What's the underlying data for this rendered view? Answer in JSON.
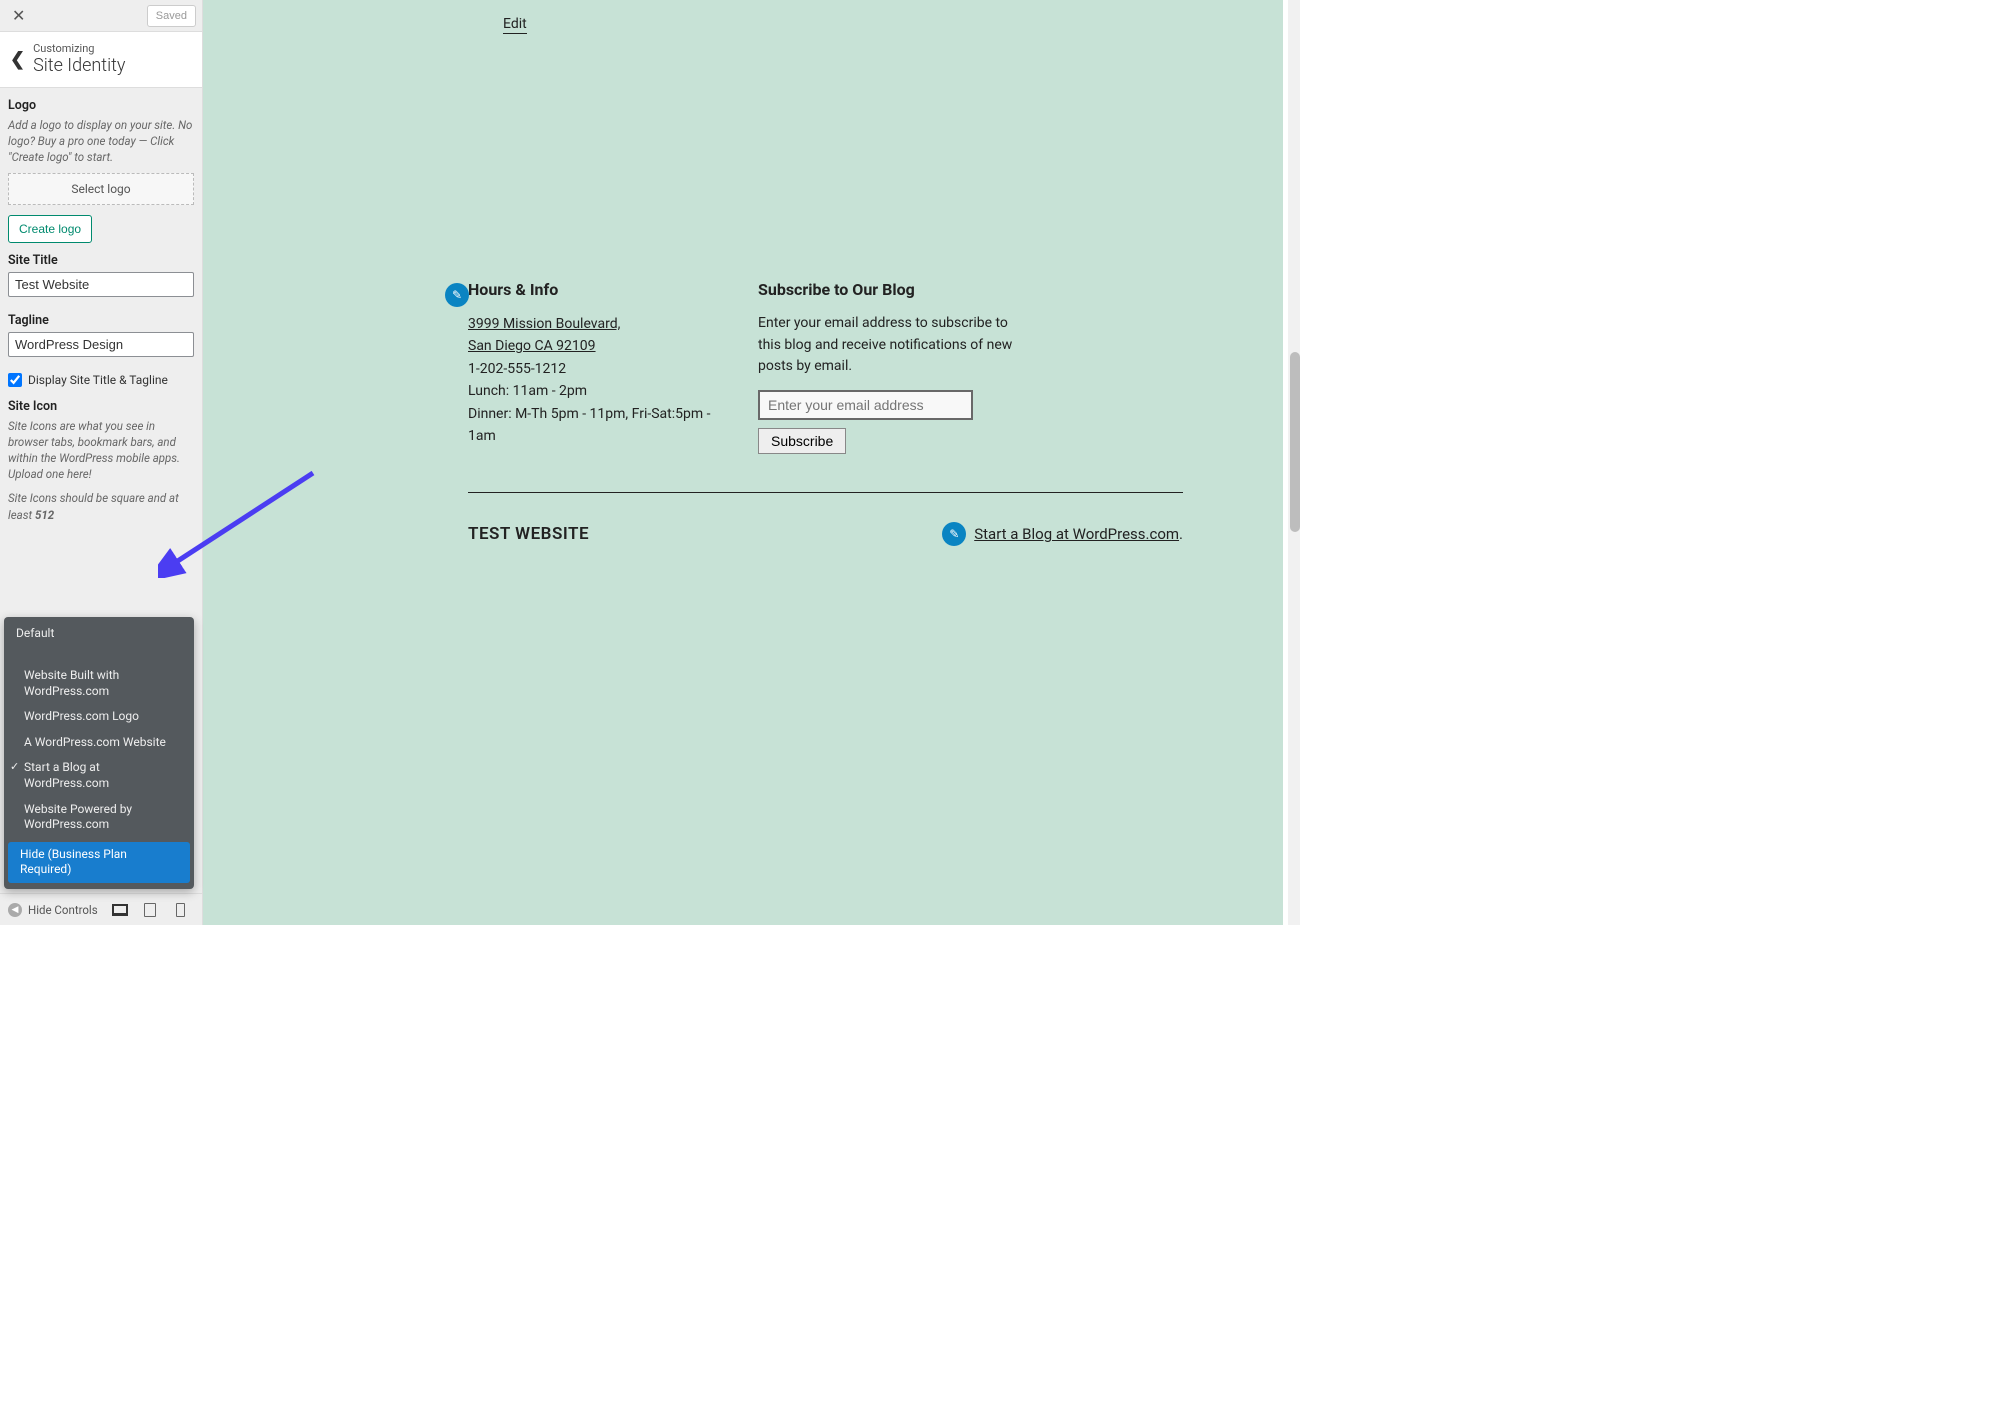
{
  "sidebar": {
    "saved_label": "Saved",
    "eyebrow": "Customizing",
    "title": "Site Identity",
    "logo": {
      "heading": "Logo",
      "help": "Add a logo to display on your site. No logo? Buy a pro one today — Click \"Create logo\" to start.",
      "select_label": "Select logo",
      "create_label": "Create logo"
    },
    "site_title": {
      "label": "Site Title",
      "value": "Test Website"
    },
    "tagline": {
      "label": "Tagline",
      "value": "WordPress Design"
    },
    "display_check_label": "Display Site Title & Tagline",
    "site_icon": {
      "heading": "Site Icon",
      "help1": "Site Icons are what you see in browser tabs, bookmark bars, and within the WordPress mobile apps. Upload one here!",
      "help2_prefix": "Site Icons should be square and at least ",
      "help2_bold": "512"
    },
    "hide_controls": "Hide Controls"
  },
  "dropdown": {
    "default": "Default",
    "items": [
      "Website Built with WordPress.com",
      "WordPress.com Logo",
      "A WordPress.com Website",
      "Start a Blog at WordPress.com",
      "Website Powered by WordPress.com"
    ],
    "checked_index": 3,
    "highlight": "Hide (Business Plan Required)"
  },
  "preview": {
    "edit_label": "Edit",
    "hours": {
      "title": "Hours & Info",
      "addr1": "3999 Mission Boulevard,",
      "addr2": "San Diego CA 92109",
      "phone": "1-202-555-1212",
      "lunch": "Lunch: 11am - 2pm",
      "dinner": "Dinner: M-Th 5pm - 11pm, Fri-Sat:5pm - 1am"
    },
    "subscribe": {
      "title": "Subscribe to Our Blog",
      "desc": "Enter your email address to subscribe to this blog and receive notifications of new posts by email.",
      "placeholder": "Enter your email address",
      "button": "Subscribe"
    },
    "footer": {
      "site_name": "TEST WEBSITE",
      "credit": "Start a Blog at WordPress.com",
      "period": "."
    }
  }
}
